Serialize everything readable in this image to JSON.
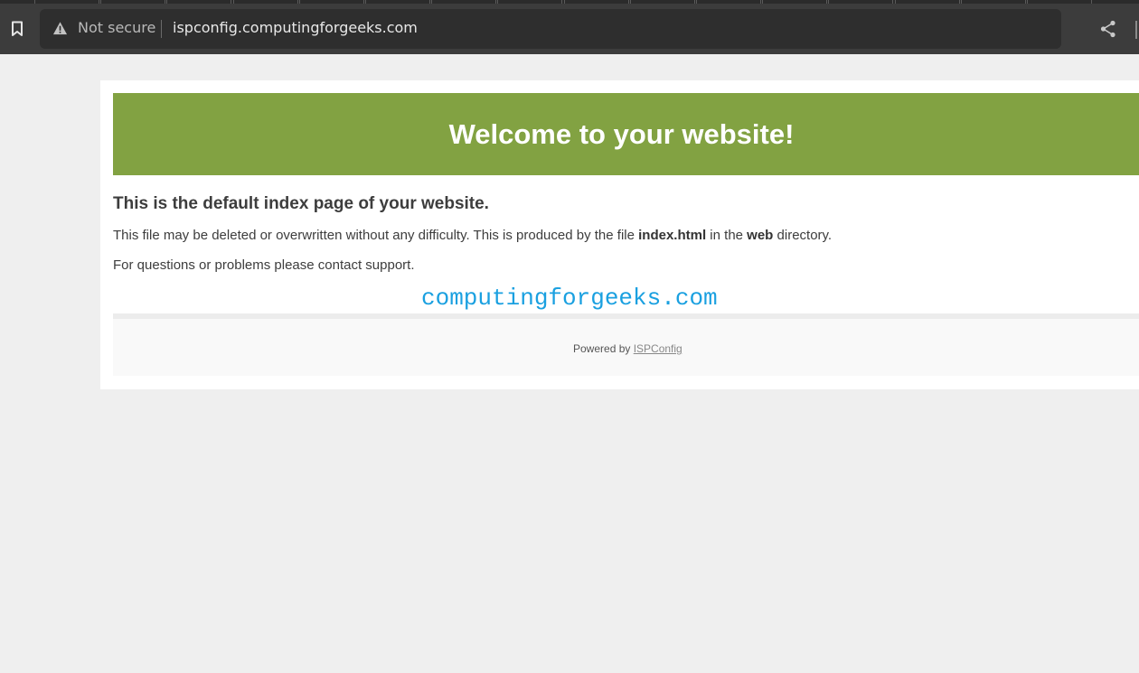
{
  "browser": {
    "tab_count": 16,
    "security_text": "Not secure",
    "url": "ispconfig.computingforgeeks.com",
    "icons": {
      "bookmark": "bookmark-icon",
      "warning": "warning-triangle-icon",
      "share": "share-icon"
    },
    "colors": {
      "toolbar": "#3c3c3c",
      "omnibox": "#2e2e2e"
    }
  },
  "page": {
    "banner_title": "Welcome to your website!",
    "subheading": "This is the default index page of your website.",
    "para1": {
      "before_file": "This file may be deleted or overwritten without any difficulty. This is produced by the file ",
      "file_name": "index.html",
      "middle": " in the ",
      "directory": "web",
      "after": " directory."
    },
    "para2": "For questions or problems please contact support.",
    "watermark": "computingforgeeks.com",
    "footer": {
      "powered_prefix": "Powered by ",
      "link_text": "ISPConfig"
    },
    "colors": {
      "banner": "#82a242",
      "watermark": "#1aa0e0",
      "background": "#efefef"
    }
  }
}
